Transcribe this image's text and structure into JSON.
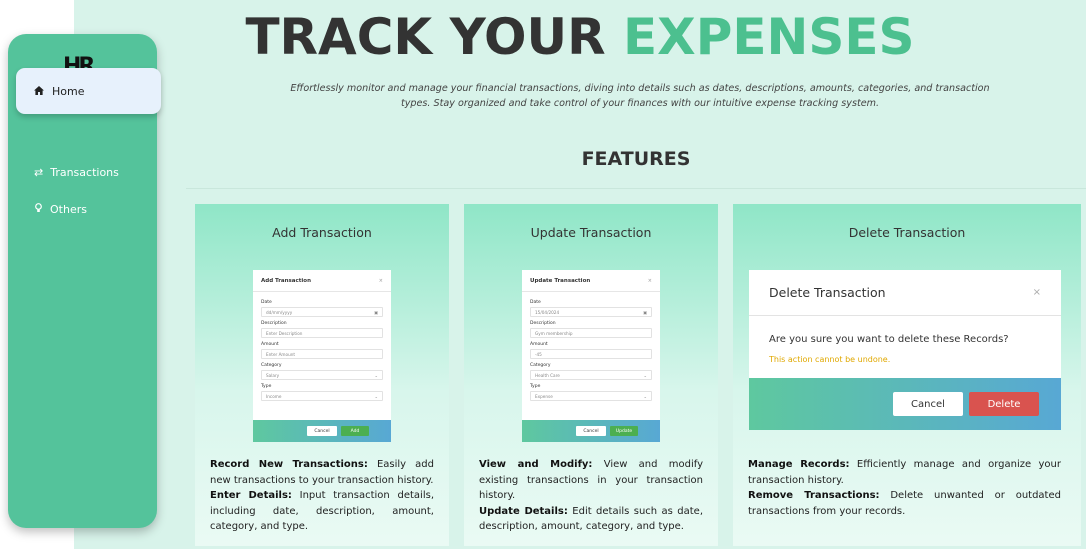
{
  "sidebar": {
    "logo": "HR",
    "items": [
      {
        "label": "Home",
        "icon": "home-icon"
      },
      {
        "label": "Transactions",
        "icon": "exchange-icon"
      },
      {
        "label": "Others",
        "icon": "lightbulb-icon"
      }
    ]
  },
  "hero": {
    "title_part1": "TRACK YOUR ",
    "title_part2": "EXPENSES",
    "description": "Effortlessly monitor and manage your financial transactions, diving into details such as dates, descriptions, amounts, categories, and transaction types. Stay organized and take control of your finances with our intuitive expense tracking system."
  },
  "features": {
    "heading": "FEATURES",
    "cards": [
      {
        "title": "Add Transaction",
        "preview": {
          "title": "Add Transaction",
          "close": "×",
          "fields": [
            {
              "label": "Date",
              "value": "dd/mm/yyyy"
            },
            {
              "label": "Description",
              "value": "Enter Description"
            },
            {
              "label": "Amount",
              "value": "Enter Amount"
            },
            {
              "label": "Category",
              "value": "Salary"
            },
            {
              "label": "Type",
              "value": "Income"
            }
          ],
          "cancel": "Cancel",
          "submit": "Add"
        },
        "desc_b1": "Record New Transactions:",
        "desc_t1": " Easily add new transactions to your transaction history.",
        "desc_b2": "Enter Details:",
        "desc_t2": " Input transaction details, including date, description, amount, category, and type."
      },
      {
        "title": "Update Transaction",
        "preview": {
          "title": "Update Transaction",
          "close": "×",
          "fields": [
            {
              "label": "Date",
              "value": "15/04/2024"
            },
            {
              "label": "Description",
              "value": "Gym membership"
            },
            {
              "label": "Amount",
              "value": "-45"
            },
            {
              "label": "Category",
              "value": "Health Care"
            },
            {
              "label": "Type",
              "value": "Expense"
            }
          ],
          "cancel": "Cancel",
          "submit": "Update"
        },
        "desc_b1": "View and Modify:",
        "desc_t1": " View and modify existing transactions in your transaction history.",
        "desc_b2": "Update Details:",
        "desc_t2": " Edit details such as date, description, amount, category, and type."
      },
      {
        "title": "Delete Transaction",
        "preview": {
          "title": "Delete Transaction",
          "close": "×",
          "question": "Are you sure you want to delete these Records?",
          "warning": "This action cannot be undone.",
          "cancel": "Cancel",
          "submit": "Delete"
        },
        "desc_b1": "Manage Records:",
        "desc_t1": " Efficiently manage and organize your transaction history.",
        "desc_b2": "Remove Transactions:",
        "desc_t2": " Delete unwanted or outdated transactions from your records."
      }
    ]
  }
}
